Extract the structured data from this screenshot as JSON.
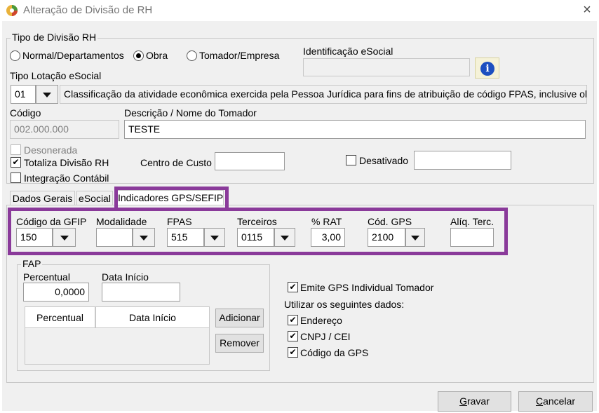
{
  "window": {
    "title": "Alteração de Divisão de RH",
    "close_icon": "×"
  },
  "tipo_divisao": {
    "legend": "Tipo de Divisão RH",
    "options": [
      {
        "label": "Normal/Departamentos",
        "selected": false
      },
      {
        "label": "Obra",
        "selected": true
      },
      {
        "label": "Tomador/Empresa",
        "selected": false
      }
    ],
    "identificacao_label": "Identificação eSocial",
    "identificacao_value": "",
    "info_icon": "i",
    "tipo_lotacao_label": "Tipo Lotação eSocial",
    "tipo_lotacao_code": "01",
    "tipo_lotacao_desc": "Classificação da atividade econômica exercida pela Pessoa Jurídica para fins de atribuição de código FPAS, inclusive obras",
    "codigo_label": "Código",
    "codigo_value": "002.000.000",
    "descricao_label": "Descrição / Nome do Tomador",
    "descricao_value": "TESTE",
    "desonerada_label": "Desonerada",
    "totaliza_label": "Totaliza Divisão RH",
    "integracao_label": "Integração Contábil",
    "centro_custo_label": "Centro de Custo",
    "centro_custo_value": "",
    "desativado_label": "Desativado",
    "desativado_value": "",
    "check_mark": "✔"
  },
  "tabs": [
    {
      "label": "Dados Gerais",
      "active": false
    },
    {
      "label": "eSocial",
      "active": false
    },
    {
      "label": "Indicadores GPS/SEFIP",
      "active": true
    }
  ],
  "gps": {
    "codigo_gfip_label": "Código da GFIP",
    "codigo_gfip_value": "150",
    "modalidade_label": "Modalidade",
    "modalidade_value": "",
    "fpas_label": "FPAS",
    "fpas_value": "515",
    "terceiros_label": "Terceiros",
    "terceiros_value": "0115",
    "rat_label": "% RAT",
    "rat_value": "3,00",
    "cod_gps_label": "Cód. GPS",
    "cod_gps_value": "2100",
    "aliq_terc_label": "Alíq. Terc.",
    "aliq_terc_value": ""
  },
  "fap": {
    "legend": "FAP",
    "percentual_label": "Percentual",
    "percentual_value": "0,0000",
    "data_inicio_label": "Data Início",
    "data_inicio_value": "",
    "columns": [
      "Percentual",
      "Data Início"
    ],
    "adicionar": "Adicionar",
    "remover": "Remover"
  },
  "opcoes": {
    "emite_gps": "Emite GPS Individual Tomador",
    "utilizar": "Utilizar os seguintes dados:",
    "endereco": "Endereço",
    "cnpj": "CNPJ / CEI",
    "codigo_gps": "Código da GPS"
  },
  "footer": {
    "gravar_first": "G",
    "gravar_rest": "ravar",
    "cancelar_first": "C",
    "cancelar_rest": "ancelar"
  },
  "colors": {
    "highlight": "#8a3a9a",
    "info_blue": "#1c4fc0"
  }
}
